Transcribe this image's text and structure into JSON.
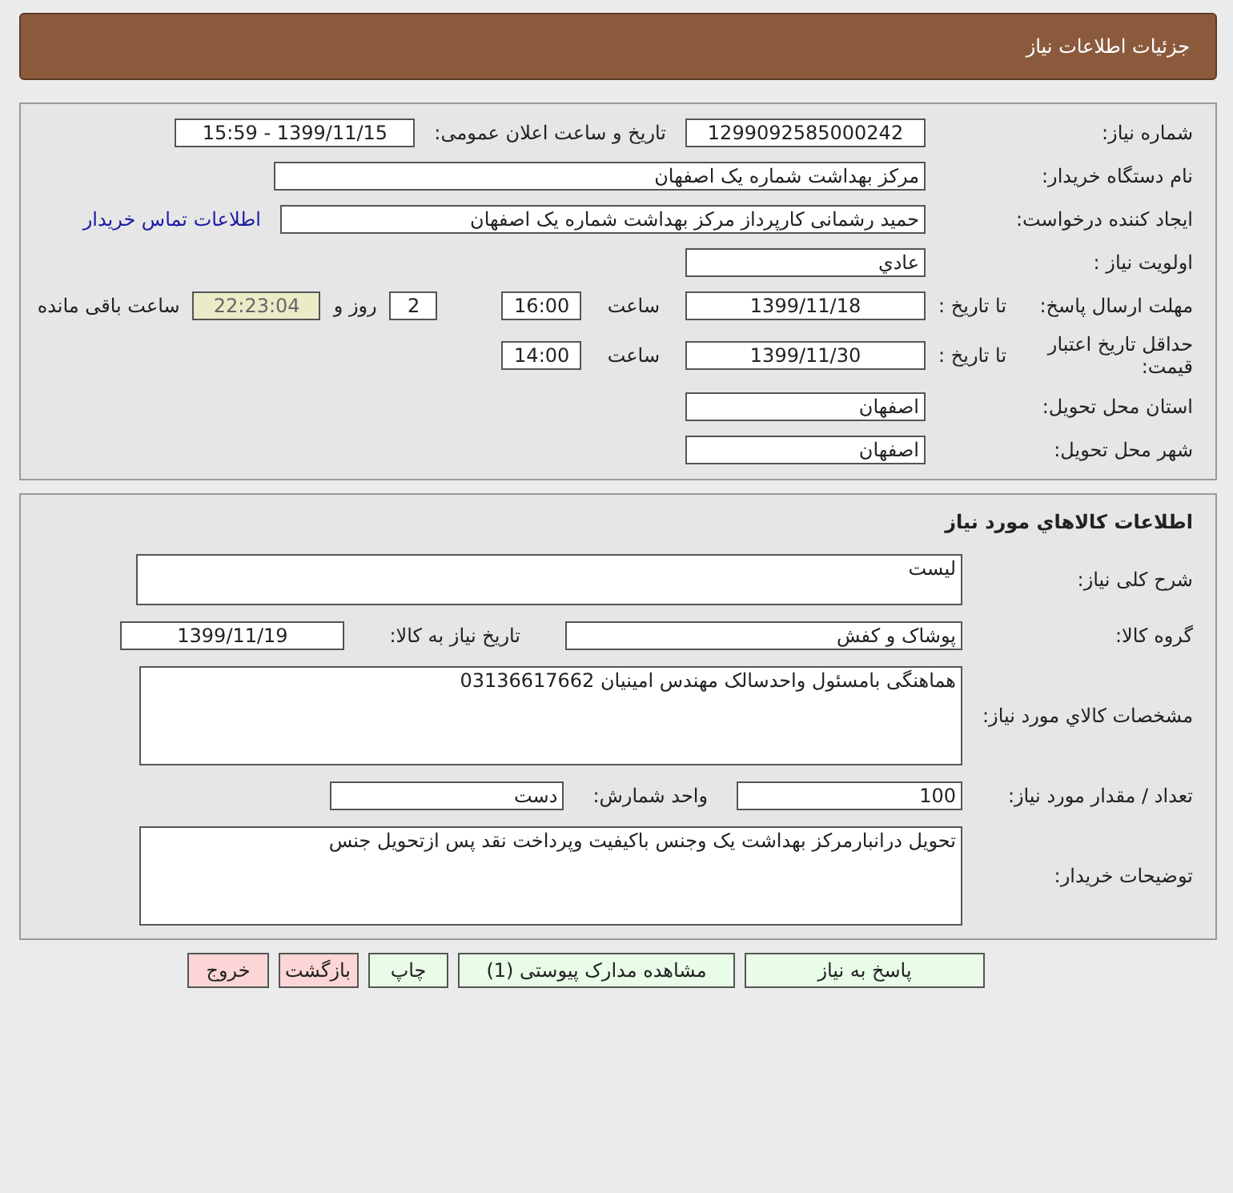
{
  "header": {
    "title": "جزئیات اطلاعات نیاز"
  },
  "need": {
    "number": {
      "label": "شماره نیاز:",
      "value": "1299092585000242"
    },
    "announce": {
      "label": "تاریخ و ساعت اعلان عمومی:",
      "value": "1399/11/15 - 15:59"
    },
    "buyer": {
      "label": "نام دستگاه خریدار:",
      "value": "مرکز بهداشت شماره یک اصفهان"
    },
    "creator": {
      "label": "ایجاد کننده درخواست:",
      "value": "حمید رشمانی کارپرداز مرکز بهداشت شماره یک اصفهان",
      "link": "اطلاعات تماس خریدار"
    },
    "priority": {
      "label": "اولویت نیاز :",
      "value": "عادي"
    },
    "deadline": {
      "label": "مهلت ارسال پاسخ:",
      "to_date_label": "تا تاریخ :",
      "date": "1399/11/18",
      "time_label": "ساعت",
      "time": "16:00",
      "days": "2",
      "days_label": "روز و",
      "remaining": "22:23:04",
      "remaining_label": "ساعت باقی مانده"
    },
    "validity": {
      "label": "حداقل تاریخ اعتبار قیمت:",
      "to_date_label": "تا تاریخ :",
      "date": "1399/11/30",
      "time_label": "ساعت",
      "time": "14:00"
    },
    "province": {
      "label": "استان محل تحویل:",
      "value": "اصفهان"
    },
    "city": {
      "label": "شهر محل تحویل:",
      "value": "اصفهان"
    }
  },
  "goods": {
    "title": "اطلاعات کالاهاي مورد نیاز",
    "summary": {
      "label": "شرح کلی نیاز:",
      "value": "لیست"
    },
    "group": {
      "label": "گروه کالا:",
      "value": "پوشاک و کفش",
      "date_label": "تاریخ نیاز به کالا:",
      "date": "1399/11/19"
    },
    "specs": {
      "label": "مشخصات کالاي مورد نیاز:",
      "value": "هماهنگی بامسئول واحدسالک مهندس امینیان 03136617662"
    },
    "quantity": {
      "label": "تعداد / مقدار مورد نیاز:",
      "value": "100",
      "unit_label": "واحد شمارش:",
      "unit": "دست"
    },
    "notes": {
      "label": "توضیحات خریدار:",
      "value": "تحویل درانبارمرکز بهداشت یک وجنس باکیفیت وپرداخت نقد پس ازتحویل جنس"
    }
  },
  "buttons": [
    {
      "label": "پاسخ به نیاز",
      "kind": "primary"
    },
    {
      "label": "مشاهده مدارک پیوستی (1)",
      "kind": "primary"
    },
    {
      "label": "چاپ",
      "kind": "primary"
    },
    {
      "label": "بازگشت",
      "kind": "danger"
    },
    {
      "label": "خروج",
      "kind": "danger"
    }
  ]
}
